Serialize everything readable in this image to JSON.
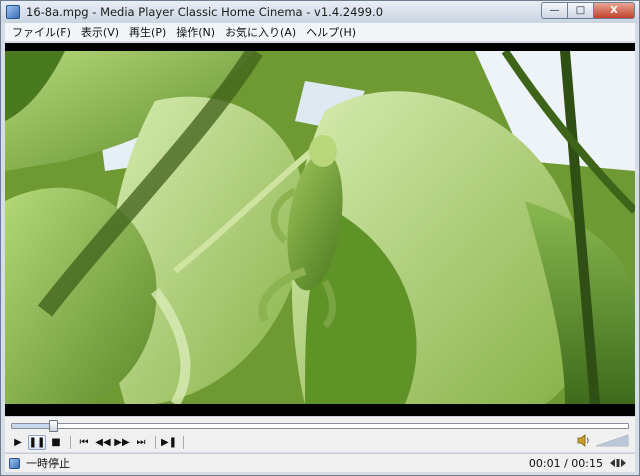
{
  "window": {
    "title": "16-8a.mpg - Media Player Classic Home Cinema - v1.4.2499.0",
    "app_icon": "mpc-hc-icon",
    "controls": {
      "minimize": "—",
      "maximize": "□",
      "close": "X"
    }
  },
  "menu": {
    "items": [
      {
        "label": "ファイル(F)"
      },
      {
        "label": "表示(V)"
      },
      {
        "label": "再生(P)"
      },
      {
        "label": "操作(N)"
      },
      {
        "label": "お気に入り(A)"
      },
      {
        "label": "ヘルプ(H)"
      }
    ]
  },
  "video": {
    "description_icons": "leaf-frog-scene"
  },
  "seek": {
    "progress": 0.067
  },
  "playback": {
    "play": "▶",
    "pause": "❚❚",
    "stop": "■",
    "prev": "⏮",
    "rewind": "◀◀",
    "forward": "▶▶",
    "next": "⏭",
    "frame_step": "▶❚"
  },
  "volume": {
    "icon": "speaker-icon",
    "level": 1.0
  },
  "status": {
    "text": "一時停止",
    "time": "00:01 / 00:15"
  },
  "colors": {
    "accent": "#3b6fb6",
    "close": "#c4402a"
  }
}
